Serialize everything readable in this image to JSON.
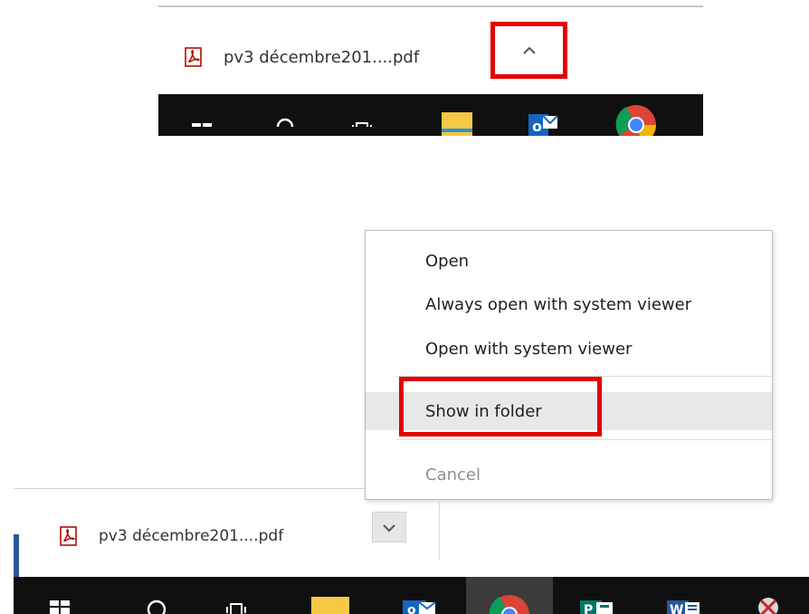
{
  "top_crop": {
    "download_item": {
      "file_name": "pv3 décembre201....pdf",
      "toggle_icon": "chevron-up-icon"
    },
    "taskbar_icons": [
      "windows-start-icon",
      "search-icon",
      "task-view-icon",
      "file-explorer-icon",
      "outlook-icon",
      "chrome-icon"
    ]
  },
  "bottom_crop": {
    "context_menu": {
      "items": [
        {
          "label": "Open"
        },
        {
          "label": "Always open with system viewer"
        },
        {
          "label": "Open with system viewer"
        },
        {
          "label": "Show in folder",
          "state": "hovered"
        },
        {
          "label": "Cancel",
          "state": "disabled"
        }
      ]
    },
    "download_item": {
      "file_name": "pv3 décembre201....pdf",
      "toggle_icon": "chevron-down-icon"
    },
    "taskbar_icons": [
      "windows-start-icon",
      "search-icon",
      "task-view-icon",
      "file-explorer-icon",
      "outlook-icon",
      "chrome-icon",
      "publisher-icon",
      "word-icon",
      "snipping-tool-icon"
    ]
  },
  "colors": {
    "highlight": "#e30000",
    "taskbar": "#101010",
    "menu_hover": "#e8e8e8",
    "pdf_red": "#b30b00",
    "accent_strip": "#2b5797"
  }
}
